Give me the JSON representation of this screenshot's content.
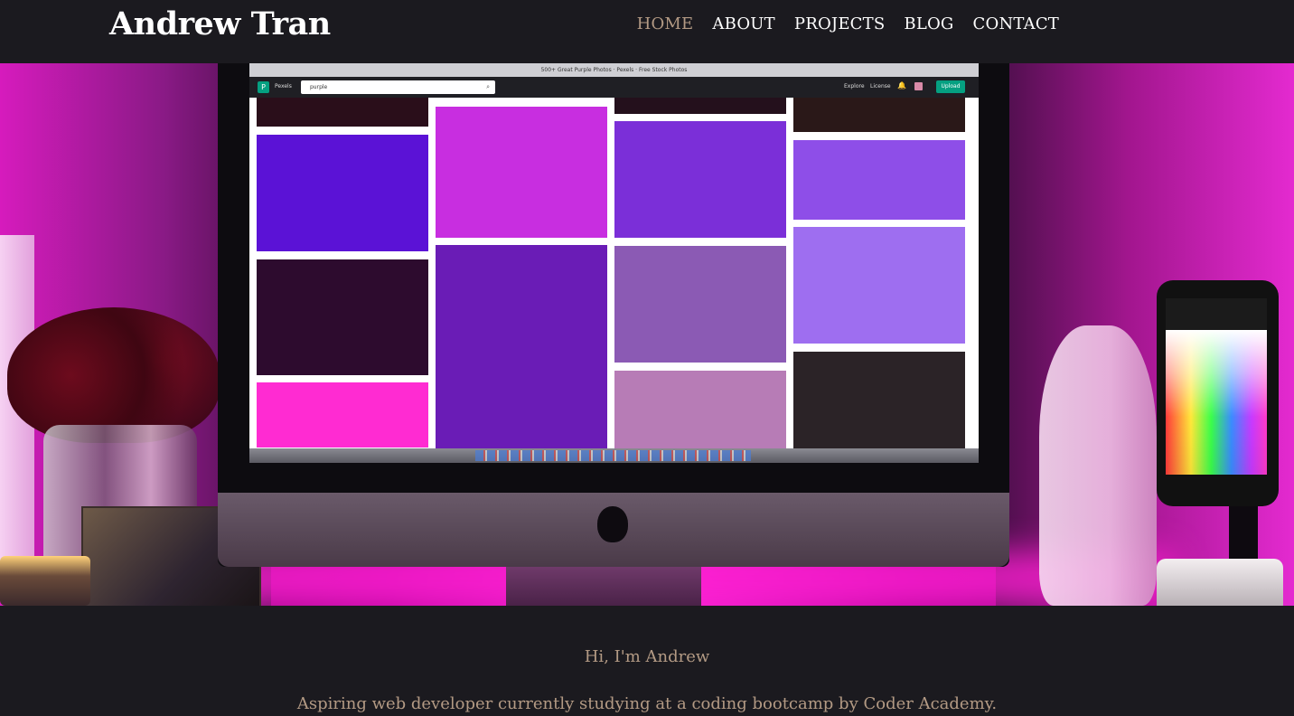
{
  "header": {
    "brand": "Andrew Tran",
    "nav": [
      {
        "label": "HOME",
        "active": true
      },
      {
        "label": "ABOUT",
        "active": false
      },
      {
        "label": "PROJECTS",
        "active": false
      },
      {
        "label": "BLOG",
        "active": false
      },
      {
        "label": "CONTACT",
        "active": false
      }
    ]
  },
  "hero": {
    "screen": {
      "window_title": "500+ Great Purple Photos · Pexels · Free Stock Photos",
      "site_name": "Pexels",
      "search_value": "purple",
      "nav_explore": "Explore",
      "nav_license": "License",
      "upload_label": "Upload",
      "tiles": [
        {
          "color": "#2a0e1a"
        },
        {
          "color": "#5b12d6"
        },
        {
          "color": "#2d0b2e"
        },
        {
          "color": "#ff2bd2"
        },
        {
          "color": "#c82ee0"
        },
        {
          "color": "#6a1cb6"
        },
        {
          "color": "#24101c"
        },
        {
          "color": "#7b2fd8"
        },
        {
          "color": "#8b5ab4"
        },
        {
          "color": "#b77cb6"
        },
        {
          "color": "#2a1818"
        },
        {
          "color": "#8e4ee8"
        },
        {
          "color": "#9e6ef0"
        },
        {
          "color": "#2b2327"
        }
      ]
    }
  },
  "intro": {
    "greeting": "Hi, I'm Andrew",
    "description": "Aspiring web developer currently studying at a coding bootcamp by Coder Academy."
  },
  "colors": {
    "background": "#1b1a1f",
    "accent": "#b39a84",
    "text": "#ffffff"
  }
}
